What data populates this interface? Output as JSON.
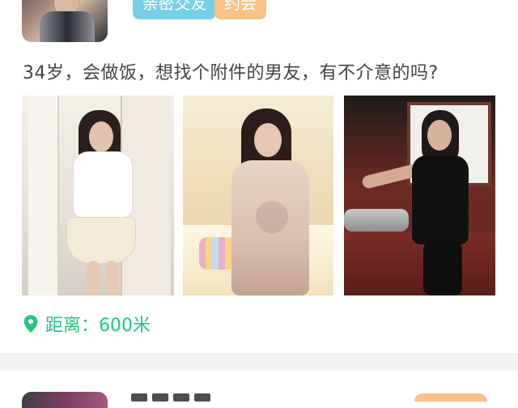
{
  "post": {
    "tags": [
      {
        "label": "亲密交友",
        "color": "#79cfe7"
      },
      {
        "label": "约会",
        "color": "#f8c185"
      }
    ],
    "text": "34岁，会做饭，想找个附件的男友，有不介意的吗?",
    "photos": [
      {
        "name": "photo-1"
      },
      {
        "name": "photo-2"
      },
      {
        "name": "photo-3"
      }
    ],
    "distance": {
      "text": "距离：600米",
      "icon": "location-pin-icon",
      "color": "#21c87a"
    }
  },
  "next_post": {
    "tag_color": "#f8c185"
  }
}
